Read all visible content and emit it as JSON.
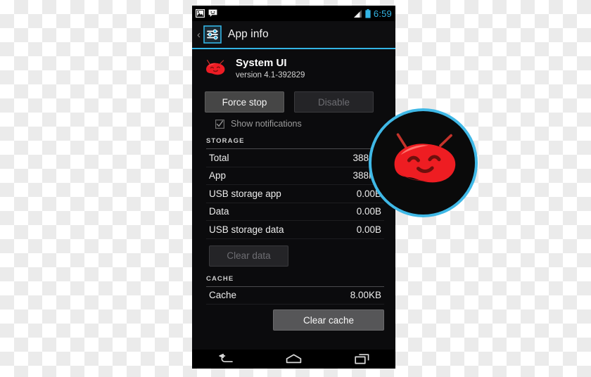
{
  "status_bar": {
    "notification_icons": [
      "image-icon",
      "messaging-icon"
    ],
    "signal_icon": "signal-bars-icon",
    "battery_icon": "battery-icon",
    "clock": "6:59",
    "accent_color": "#33b5e5"
  },
  "action_bar": {
    "back_chevron": "‹",
    "app_icon": "settings-sliders-icon",
    "title": "App info"
  },
  "app": {
    "icon": "android-jellybean-red-icon",
    "name": "System UI",
    "version": "version 4.1-392829"
  },
  "actions": {
    "force_stop": {
      "label": "Force stop",
      "enabled": true
    },
    "disable": {
      "label": "Disable",
      "enabled": false
    }
  },
  "show_notifications": {
    "label": "Show notifications",
    "checked": true,
    "enabled": false
  },
  "storage": {
    "section_label": "STORAGE",
    "rows": [
      {
        "key": "Total",
        "value": "388KB"
      },
      {
        "key": "App",
        "value": "388KB"
      },
      {
        "key": "USB storage app",
        "value": "0.00B"
      },
      {
        "key": "Data",
        "value": "0.00B"
      },
      {
        "key": "USB storage data",
        "value": "0.00B"
      }
    ],
    "clear_data": {
      "label": "Clear data",
      "enabled": false
    }
  },
  "cache": {
    "section_label": "CACHE",
    "rows": [
      {
        "key": "Cache",
        "value": "8.00KB"
      }
    ],
    "clear_cache": {
      "label": "Clear cache",
      "enabled": true
    }
  },
  "nav_bar": {
    "back": "back-nav-icon",
    "home": "home-nav-icon",
    "recents": "recents-nav-icon"
  },
  "magnifier": {
    "content_icon": "android-jellybean-red-icon",
    "ring_color": "#3fb8e6"
  }
}
